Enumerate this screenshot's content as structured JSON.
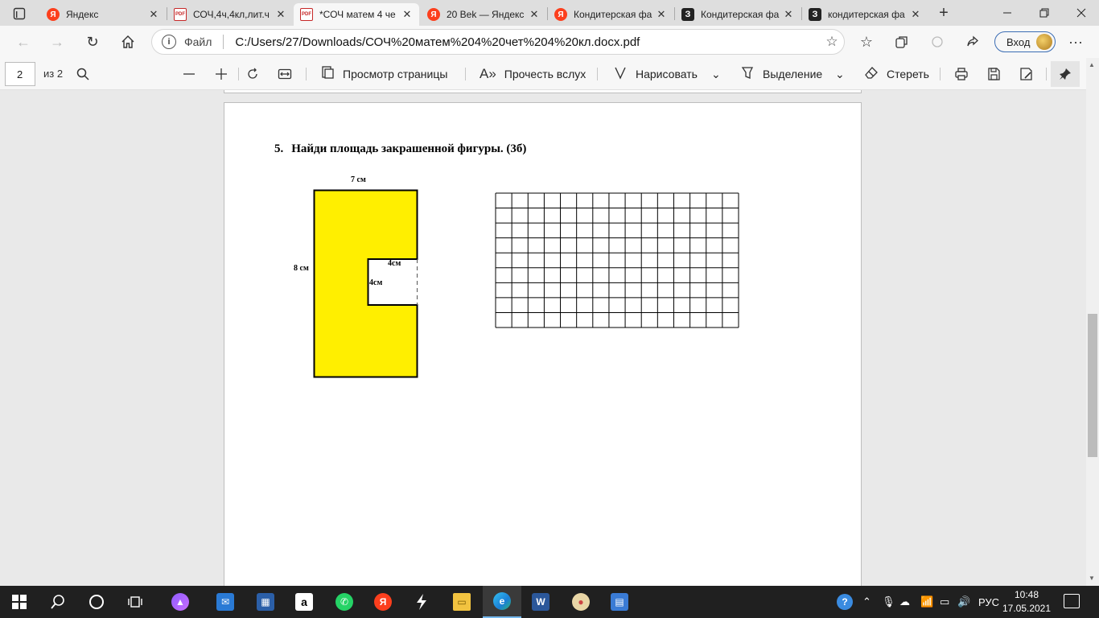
{
  "tabs": [
    {
      "title": "Яндекс",
      "icon": "yandex-icon"
    },
    {
      "title": "СОЧ,4ч,4кл,лит.ч",
      "icon": "pdf-icon"
    },
    {
      "title": "*СОЧ матем 4 че",
      "icon": "pdf-icon",
      "active": true
    },
    {
      "title": "20 Bek — Яндекс",
      "icon": "yandex-icon"
    },
    {
      "title": "Кондитерская фа",
      "icon": "yandex-icon"
    },
    {
      "title": "Кондитерская фа",
      "icon": "z-icon"
    },
    {
      "title": "кондитерская фа",
      "icon": "z-icon"
    }
  ],
  "address": {
    "scheme": "Файл",
    "url": "C:/Users/27/Downloads/СОЧ%20матем%204%20чет%204%20кл.docx.pdf"
  },
  "signin": {
    "label": "Вход"
  },
  "pdf_toolbar": {
    "page_number": "2",
    "page_total": "из 2",
    "page_view": "Просмотр страницы",
    "read_aloud": "Прочесть вслух",
    "draw": "Нарисовать",
    "highlight": "Выделение",
    "erase": "Стереть"
  },
  "document": {
    "task_number": "5.",
    "task_text": "Найди площадь закрашенной фигуры.  (3б)",
    "figure": {
      "fill_color": "#ffef00",
      "label_top": "7 см",
      "label_left": "8 см",
      "label_notch_width": "4см",
      "label_notch_height": "4см"
    },
    "grid": {
      "columns": 15,
      "rows": 9
    }
  },
  "taskbar": {
    "language": "РУС",
    "time": "10:48",
    "date": "17.05.2021"
  }
}
